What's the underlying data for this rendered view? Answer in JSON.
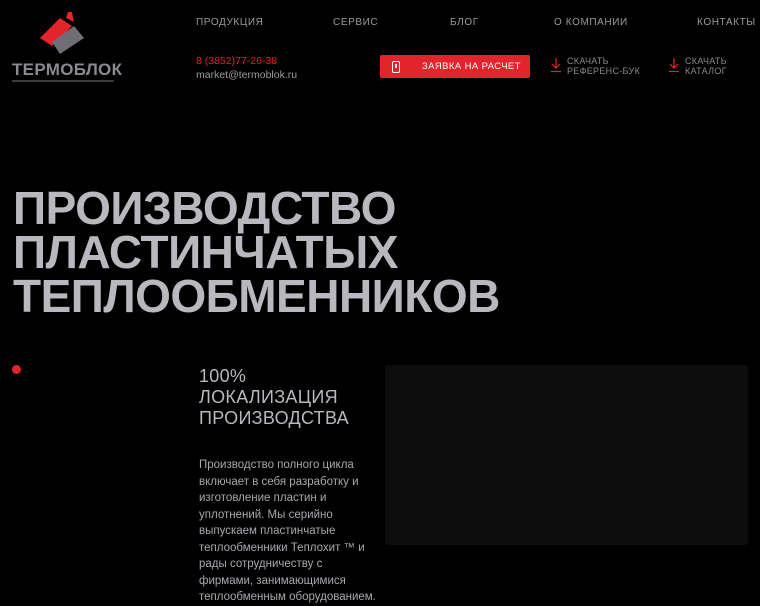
{
  "logo": {
    "name": "ТЕРМОБЛОК",
    "mark_colors": {
      "red": "#e3242b",
      "gray": "#6e6e74"
    }
  },
  "nav": {
    "items": [
      {
        "label": "ПРОДУКЦИЯ"
      },
      {
        "label": "СЕРВИС"
      },
      {
        "label": "БЛОГ"
      },
      {
        "label": "О КОМПАНИИ"
      },
      {
        "label": "КОНТАКТЫ"
      }
    ]
  },
  "contact": {
    "phone": "8 (3852)77-26-38",
    "email": "market@termoblok.ru"
  },
  "cta": {
    "label": "ЗАЯВКА НА РАСЧЕТ",
    "icon": "phone-icon"
  },
  "downloads": [
    {
      "label": "СКАЧАТЬ\nРЕФЕРЕНС-БУК",
      "icon": "download-icon"
    },
    {
      "label": "СКАЧАТЬ\nКАТАЛОГ",
      "icon": "download-icon"
    }
  ],
  "hero": {
    "title_lines": [
      "ПРОИЗВОДСТВО",
      "ПЛАСТИНЧАТЫХ",
      "ТЕПЛООБМЕННИКОВ"
    ]
  },
  "feature": {
    "title_lines": [
      "100%",
      "ЛОКАЛИЗАЦИЯ",
      "ПРОИЗВОДСТВА"
    ],
    "text": "Производство полного цикла включает в себя разработку и изготовление пластин и уплотнений. Мы серийно выпускаем пластинчатые теплообменники Теплохит ™ и рады сотрудничеству с фирмами, занимающимися теплообменным оборудованием."
  },
  "colors": {
    "accent": "#e3242b",
    "background": "#000000",
    "text": "#b8b8be"
  }
}
